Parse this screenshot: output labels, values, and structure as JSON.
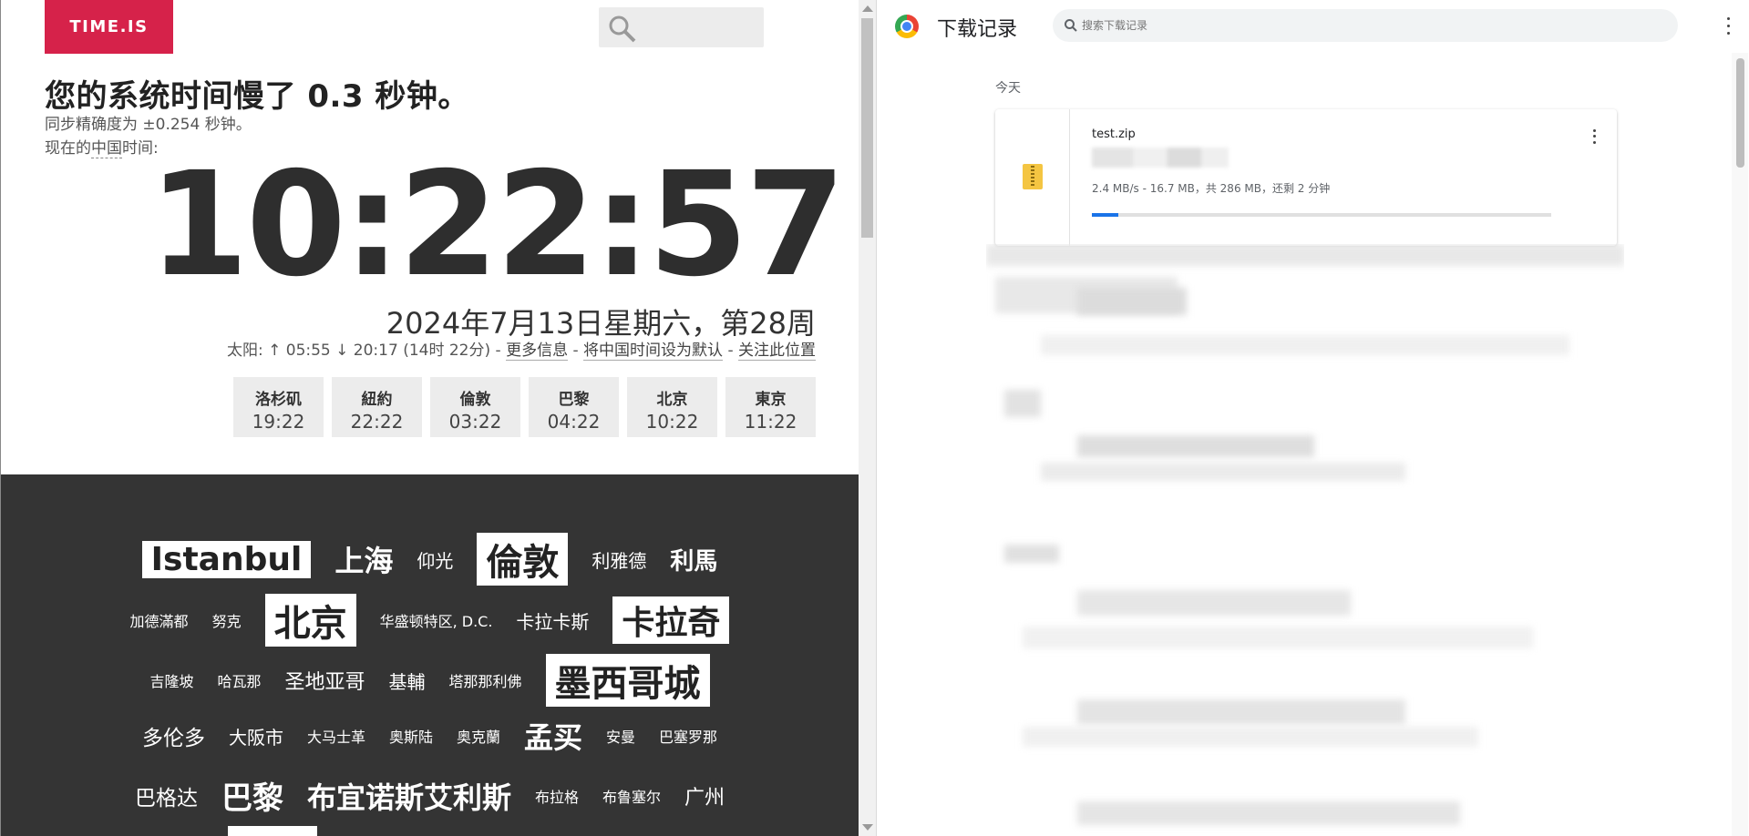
{
  "time_site": {
    "logo": "TIME.IS",
    "headline": "您的系统时间慢了 0.3 秒钟。",
    "accuracy": "同步精确度为 ±0.254 秒钟。",
    "now_prefix": "现在的",
    "now_place": "中国",
    "now_suffix": "时间:",
    "clock": "10:22:57",
    "date": "2024年7月13日星期六，第28周",
    "sun_label": "太阳:",
    "sun_times": "↑ 05:55 ↓ 20:17 (14时 22分)",
    "sep": "-",
    "more_info": "更多信息",
    "set_default": "将中国时间设为默认",
    "follow": "关注此位置",
    "cities": [
      {
        "name": "洛杉矶",
        "time": "19:22"
      },
      {
        "name": "紐約",
        "time": "22:22"
      },
      {
        "name": "倫敦",
        "time": "03:22"
      },
      {
        "name": "巴黎",
        "time": "04:22"
      },
      {
        "name": "北京",
        "time": "10:22"
      },
      {
        "name": "東京",
        "time": "11:22"
      }
    ],
    "cloud_rows": [
      [
        "Istanbul",
        "上海",
        "仰光",
        "倫敦",
        "利雅德",
        "利馬"
      ],
      [
        "加德滿都",
        "努克",
        "北京",
        "华盛顿特区, D.C.",
        "卡拉卡斯",
        "卡拉奇"
      ],
      [
        "吉隆坡",
        "哈瓦那",
        "圣地亚哥",
        "基輔",
        "塔那那利佛",
        "墨西哥城"
      ],
      [
        "多伦多",
        "大阪市",
        "大马士革",
        "奥斯陆",
        "奥克蘭",
        "孟买",
        "安曼",
        "巴塞罗那"
      ],
      [
        "巴格达",
        "巴黎",
        "布宜诺斯艾利斯",
        "布拉格",
        "布鲁塞尔",
        "广州"
      ]
    ]
  },
  "downloads": {
    "title": "下载记录",
    "search_placeholder": "搜索下载记录",
    "section": "今天",
    "item": {
      "filename": "test.zip",
      "status": "2.4 MB/s - 16.7 MB，共 286 MB，还剩 2 分钟",
      "progress": 0.058
    }
  },
  "colors": {
    "brand_red": "#d6224a",
    "dark_bg": "#343434",
    "progress_blue": "#1a73e8"
  },
  "icons": [
    "search-icon",
    "chrome-icon",
    "more-vert-icon",
    "zip-file-icon"
  ]
}
